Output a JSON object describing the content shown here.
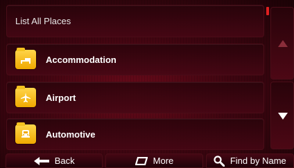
{
  "list": {
    "header_label": "List All Places",
    "items": [
      {
        "label": "Accommodation",
        "icon": "bed-icon"
      },
      {
        "label": "Airport",
        "icon": "airplane-icon"
      },
      {
        "label": "Automotive",
        "icon": "car-icon"
      }
    ]
  },
  "scroll": {
    "up_icon": "arrow-up-icon",
    "down_icon": "arrow-down-icon"
  },
  "bottom_bar": {
    "back_label": "Back",
    "more_label": "More",
    "find_label": "Find by Name"
  },
  "colors": {
    "background": "#3e0510",
    "icon_yellow": "#f0a900",
    "scroll_indicator": "#e02020"
  }
}
